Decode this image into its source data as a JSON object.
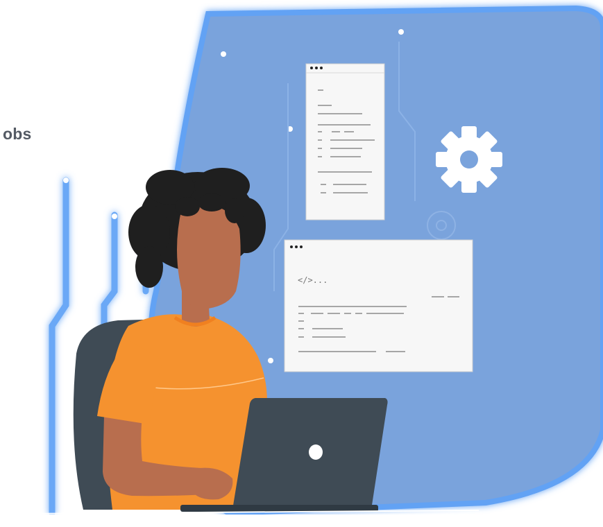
{
  "partial_heading": "obs",
  "code_window": {
    "code_tag": "</>..."
  },
  "colors": {
    "backdrop": "#7aa3dc",
    "glow": "#5b9bf0",
    "shirt": "#f5922f",
    "skin": "#b86e4e",
    "hair": "#1f1f1f",
    "laptop": "#3f4b55",
    "chair": "#3f4b55",
    "gear": "#ffffff"
  }
}
